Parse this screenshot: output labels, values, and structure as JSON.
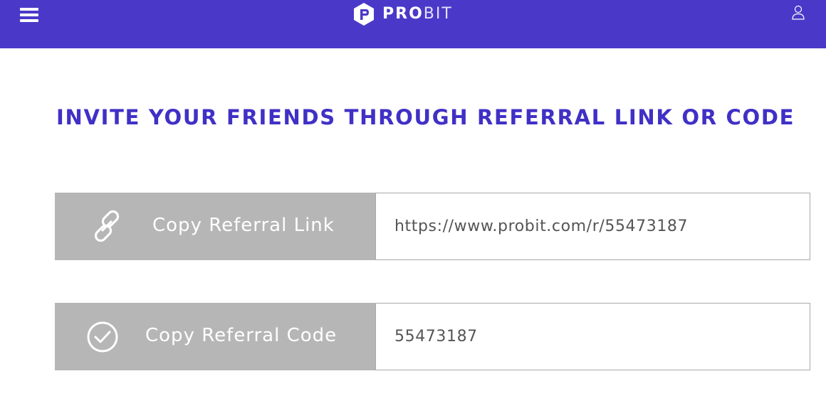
{
  "header": {
    "menu_icon": "hamburger-menu-icon",
    "logo": {
      "icon": "probit-logo-icon",
      "text_bold": "PRO",
      "text_light": "BIT"
    },
    "user_icon": "user-icon",
    "background_color": "#4a39c9"
  },
  "main": {
    "heading": "INVITE YOUR FRIENDS THROUGH REFERRAL LINK OR CODE",
    "heading_color": "#4030c6",
    "referral_link": {
      "icon": "link-icon",
      "button_label": "Copy Referral Link",
      "value": "https://www.probit.com/r/55473187"
    },
    "referral_code": {
      "icon": "check-circle-icon",
      "button_label": "Copy Referral Code",
      "value": "55473187"
    },
    "button_color": "#b6b6b6"
  }
}
